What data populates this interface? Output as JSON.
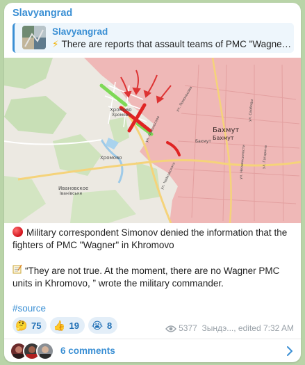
{
  "message": {
    "channel_name": "Slavyangrad",
    "reply": {
      "title": "Slavyangrad",
      "bolt_icon": "lightning-emoji-icon",
      "text": "There are reports that assault teams of PMC \"Wagner\" are in Khromovo"
    },
    "map": {
      "labels": {
        "khromovo_1": "Хромово",
        "khromovo_2": "Хромовo",
        "khromovo_3": "Хромово",
        "bakhmut_1": "Бахмут",
        "bakhmut_2": "Бахмут",
        "bakhmut_3": "Бахмут",
        "ivanovskoe_1": "Ивановское",
        "ivanovskoe_2": "Іванівське",
        "street_1": "ул. Ломоносова",
        "street_2": "ул. Чайковского",
        "street_3": "ул. Ломоносова",
        "street_4": "ул. Свободы",
        "street_5": "ул. Независимости",
        "street_6": "ул. Гагарина"
      }
    },
    "paragraphs": {
      "p1_text": "Military correspondent Simonov denied the information that the fighters of PMC \"Wagner\" in Khromovo",
      "p2_text": "“They are not true. At the moment, there are no Wagner PMC units in Khromovo, ” wrote the military commander.",
      "hashtag": "#source"
    },
    "reactions": [
      {
        "emoji": "🤔",
        "icon": "thinking-face-icon",
        "count": "75"
      },
      {
        "emoji": "👍",
        "icon": "thumbs-up-icon",
        "count": "19"
      },
      {
        "emoji": "😭",
        "icon": "crying-face-icon",
        "count": "8"
      }
    ],
    "views": "5377",
    "author_edited": "Зындэ..., edited 7:32 AM",
    "comments_label": "6 comments",
    "colors": {
      "accent": "#3a8fd4",
      "reaction_bg": "#e3eef8",
      "occupied_area": "#f0b3b3",
      "frontline_green": "#7ed957",
      "frontline_red": "#e02424"
    }
  }
}
